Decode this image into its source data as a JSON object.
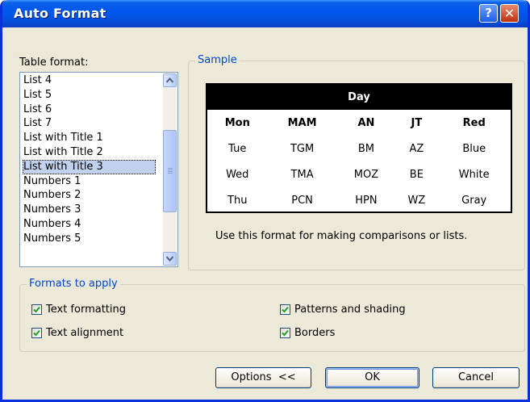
{
  "window": {
    "title": "Auto Format",
    "help_label": "?",
    "close_label": "✕"
  },
  "table_format": {
    "label": "Table format:",
    "items": [
      "List 4",
      "List 5",
      "List 6",
      "List 7",
      "List with Title 1",
      "List with Title 2",
      "List with Title 3",
      "Numbers 1",
      "Numbers 2",
      "Numbers 3",
      "Numbers 4",
      "Numbers 5"
    ],
    "selected": "List with Title 3"
  },
  "sample": {
    "legend": "Sample",
    "header": "Day",
    "columns": [
      "Mon",
      "MAM",
      "AN",
      "JT",
      "Red"
    ],
    "rows": [
      [
        "Tue",
        "TGM",
        "BM",
        "AZ",
        "Blue"
      ],
      [
        "Wed",
        "TMA",
        "MOZ",
        "BE",
        "White"
      ],
      [
        "Thu",
        "PCN",
        "HPN",
        "WZ",
        "Gray"
      ]
    ],
    "description": "Use this format for making comparisons or lists."
  },
  "formats": {
    "legend": "Formats to apply",
    "text_formatting": "Text formatting",
    "text_alignment": "Text alignment",
    "patterns_shading": "Patterns and shading",
    "borders": "Borders"
  },
  "buttons": {
    "options": "Options  <<",
    "ok": "OK",
    "cancel": "Cancel"
  },
  "colors": {
    "titlebar": "#0058EE",
    "dialog_bg": "#ECE9D8",
    "legend_text": "#0046D5",
    "selection": "#C1D2EE"
  }
}
